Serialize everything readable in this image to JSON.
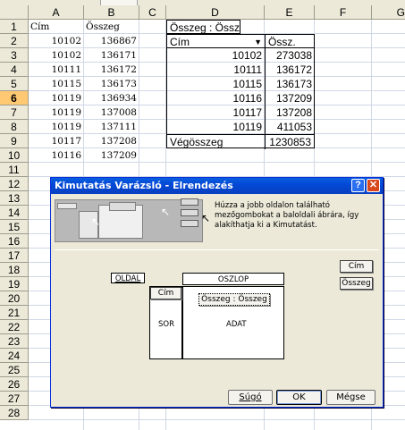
{
  "sheet": {
    "columns": [
      "A",
      "B",
      "C",
      "D",
      "E",
      "F",
      "G"
    ],
    "rows": [
      "1",
      "2",
      "3",
      "4",
      "5",
      "6",
      "7",
      "8",
      "9",
      "10",
      "11",
      "12",
      "13",
      "14",
      "15",
      "16",
      "17",
      "18",
      "19",
      "20",
      "21",
      "22",
      "23",
      "24",
      "25",
      "26",
      "27",
      "28"
    ],
    "source": {
      "headers": [
        "Cím",
        "Összeg"
      ],
      "rows": [
        [
          "10102",
          "136867"
        ],
        [
          "10102",
          "136171"
        ],
        [
          "10111",
          "136172"
        ],
        [
          "10115",
          "136173"
        ],
        [
          "10119",
          "136934"
        ],
        [
          "10119",
          "137008"
        ],
        [
          "10119",
          "137111"
        ],
        [
          "10117",
          "137208"
        ],
        [
          "10116",
          "137209"
        ]
      ]
    },
    "pivot": {
      "title": "Összeg : Összeg",
      "row_field": "Cím",
      "data_header": "Össz.",
      "rows": [
        [
          "10102",
          "273038"
        ],
        [
          "10111",
          "136172"
        ],
        [
          "10115",
          "136173"
        ],
        [
          "10116",
          "137209"
        ],
        [
          "10117",
          "137208"
        ],
        [
          "10119",
          "411053"
        ]
      ],
      "total_label": "Végösszeg",
      "total_value": "1230853"
    }
  },
  "dialog": {
    "title": "Kimutatás Varázsló - Elrendezés",
    "help_label": "?",
    "close_label": "✕",
    "instructions": "Húzza a jobb oldalon található mezőgombokat a baloldali ábrára, így alakíthatja ki a Kimutatást.",
    "layout": {
      "page_label": "OLDAL",
      "column_label": "OSZLOP",
      "row_label": "SOR",
      "data_label": "ADAT",
      "row_field": "Cím",
      "data_field": "Összeg : Összeg"
    },
    "fields": [
      "Cím",
      "Összeg"
    ],
    "buttons": {
      "help": "Súgó",
      "ok": "OK",
      "cancel": "Mégse"
    }
  },
  "colors": {
    "title_bar": "#0349d6",
    "selected_header": "#ffc873",
    "grid": "#d0d7e5",
    "dialog_bg": "#ece9d8"
  }
}
